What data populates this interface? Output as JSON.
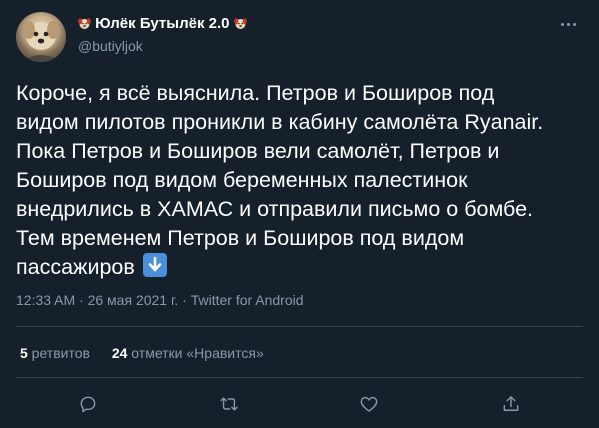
{
  "tweet": {
    "author": {
      "display_name": "Юлёк Бутылёк 2.0",
      "handle": "@butiyljok"
    },
    "body_lines": [
      "Короче, я всё выяснила. Петров и Боширов под",
      "видом пилотов проникли в кабину самолёта Ryanair.",
      "Пока Петров и Боширов вели самолёт, Петров и",
      "Боширов под видом беременных палестинок",
      "внедрились в ХАМАС и отправили письмо о бомбе.",
      "Тем временем Петров и Боширов под видом",
      "пассажиров"
    ],
    "timestamp": "12:33 AM · 26 мая 2021 г. · ",
    "source": "Twitter for Android",
    "retweets": {
      "count": "5",
      "label": " ретвитов"
    },
    "likes": {
      "count": "24",
      "label": " отметки «Нравится»"
    },
    "icons": {
      "name_emoji": "dog-face-emoji",
      "body_emoji": "down-arrow-emoji",
      "more": "more-icon",
      "reply": "reply-icon",
      "retweet": "retweet-icon",
      "like": "heart-icon",
      "share": "share-icon"
    },
    "colors": {
      "background": "#15202b",
      "text": "#ffffff",
      "secondary": "#8899a6",
      "divider": "#38444d",
      "emoji_blue": "#4a8fd9"
    }
  }
}
